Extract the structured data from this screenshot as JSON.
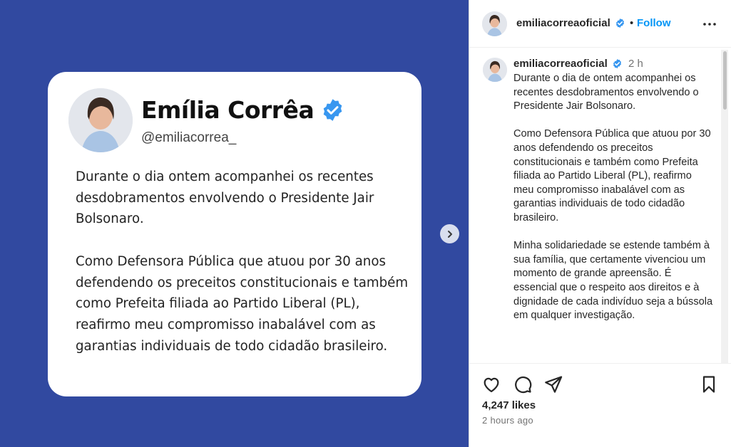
{
  "card": {
    "name": "Emília Corrêa",
    "handle": "@emiliacorrea_",
    "text": "Durante o dia ontem acompanhei os recentes desdobramentos envolvendo o Presidente Jair Bolsonaro.\n\nComo Defensora Pública que atuou por 30 anos defendendo os preceitos constitucionais e também como Prefeita filiada ao Partido Liberal (PL), reafirmo meu compromisso inabalável com as garantias individuais de todo cidadão brasileiro."
  },
  "header": {
    "username": "emiliacorreaoficial",
    "separator": "•",
    "follow_label": "Follow",
    "more_icon": "more-horizontal-icon"
  },
  "caption": {
    "username": "emiliacorreaoficial",
    "time": "2 h",
    "text": "Durante o dia de ontem acompanhei os recentes desdobramentos envolvendo o Presidente Jair Bolsonaro.\n\nComo Defensora Pública que atuou por 30 anos defendendo os preceitos constitucionais e também como Prefeita filiada ao Partido Liberal (PL), reafirmo meu compromisso inabalável com as garantias individuais de todo cidadão brasileiro.\n\nMinha solidariedade se estende também à sua família, que certamente vivenciou um momento de grande apreensão. É essencial que o respeito aos direitos e à dignidade de cada indivíduo seja a bússola em qualquer investigação."
  },
  "actions": {
    "likes": "4,247 likes",
    "time_ago": "2 hours ago",
    "icons": [
      "heart-icon",
      "comment-icon",
      "share-icon",
      "bookmark-icon"
    ]
  },
  "colors": {
    "media_background": "#3149a0",
    "verified": "#3897f0",
    "follow": "#0095f6"
  }
}
